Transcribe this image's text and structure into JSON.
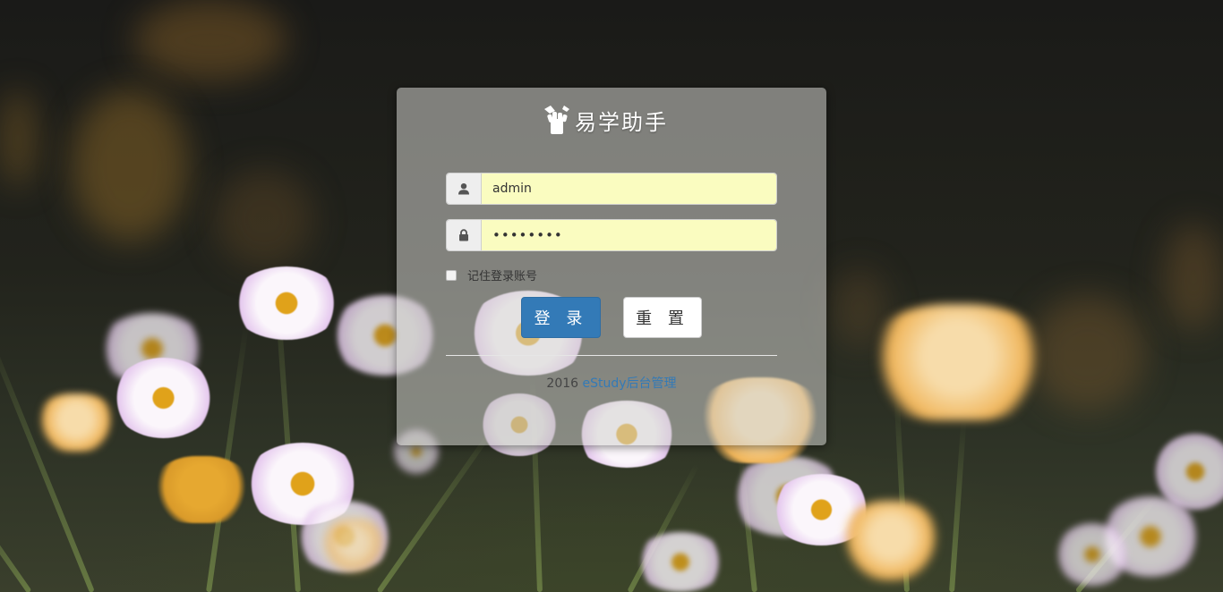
{
  "brand": {
    "title": "易学助手",
    "icon": "fist-icon"
  },
  "form": {
    "username": {
      "icon": "user-icon",
      "value": "admin"
    },
    "password": {
      "icon": "lock-icon",
      "value": "••••••••"
    },
    "remember_label": "记住登录账号",
    "remember_checked": false
  },
  "buttons": {
    "login_label": "登 录",
    "reset_label": "重 置"
  },
  "footer": {
    "year": "2016",
    "link_text": "eStudy后台管理"
  },
  "colors": {
    "primary": "#337ab7",
    "field_bg": "#fafcc0"
  }
}
